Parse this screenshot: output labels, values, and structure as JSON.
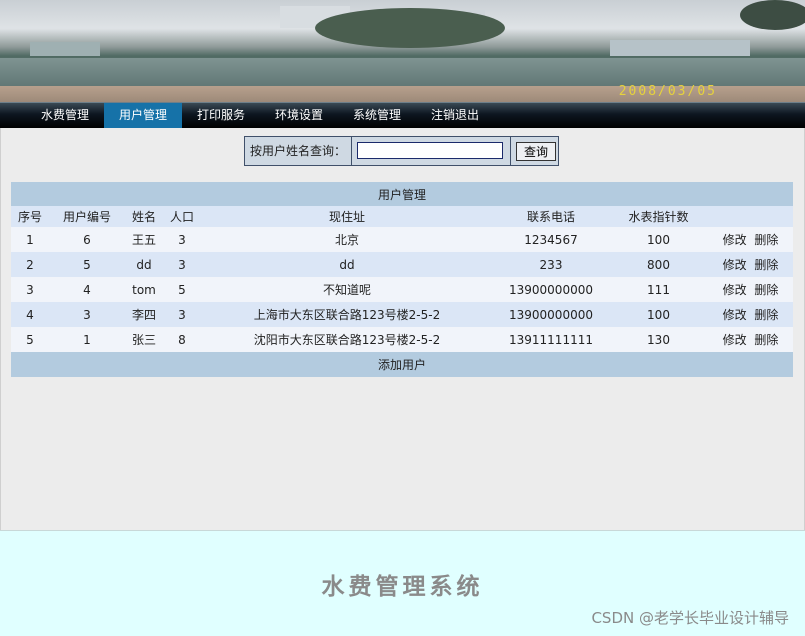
{
  "banner": {
    "date_stamp": "2008/03/05"
  },
  "nav": {
    "items": [
      {
        "label": "水费管理"
      },
      {
        "label": "用户管理"
      },
      {
        "label": "打印服务"
      },
      {
        "label": "环境设置"
      },
      {
        "label": "系统管理"
      },
      {
        "label": "注销退出"
      }
    ],
    "active_index": 1
  },
  "search": {
    "label": "按用户姓名查询：",
    "value": "",
    "button_label": "查询"
  },
  "table": {
    "caption": "用户管理",
    "columns": [
      "序号",
      "用户编号",
      "姓名",
      "人口",
      "现住址",
      "联系电话",
      "水表指针数",
      ""
    ],
    "rows": [
      {
        "seq": "1",
        "user_id": "6",
        "name": "王五",
        "people": "3",
        "address": "北京",
        "phone": "1234567",
        "meter": "100"
      },
      {
        "seq": "2",
        "user_id": "5",
        "name": "dd",
        "people": "3",
        "address": "dd",
        "phone": "233",
        "meter": "800"
      },
      {
        "seq": "3",
        "user_id": "4",
        "name": "tom",
        "people": "5",
        "address": "不知道呢",
        "phone": "13900000000",
        "meter": "111"
      },
      {
        "seq": "4",
        "user_id": "3",
        "name": "李四",
        "people": "3",
        "address": "上海市大东区联合路123号楼2-5-2",
        "phone": "13900000000",
        "meter": "100"
      },
      {
        "seq": "5",
        "user_id": "1",
        "name": "张三",
        "people": "8",
        "address": "沈阳市大东区联合路123号楼2-5-2",
        "phone": "13911111111",
        "meter": "130"
      }
    ],
    "edit_label": "修改",
    "delete_label": "删除",
    "add_label": "添加用户"
  },
  "footer": {
    "brand": "水费管理系统",
    "watermark": "CSDN @老学长毕业设计辅导"
  },
  "colors": {
    "nav_active": "#1672a8",
    "table_caption_bg": "#b3cbdf",
    "row_alt_bg": "#dbe6f6",
    "footer_bg": "#e0ffff"
  }
}
